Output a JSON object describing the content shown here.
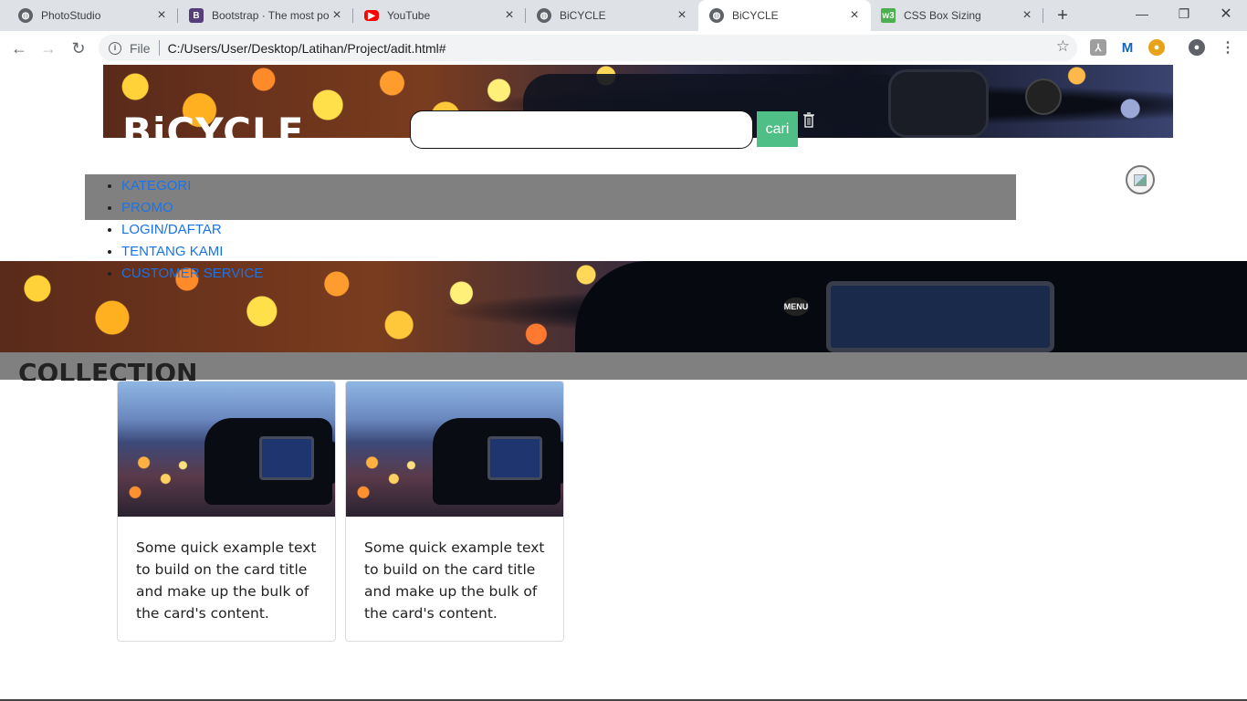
{
  "browser": {
    "tabs": [
      {
        "title": "PhotoStudio",
        "icon": "globe-icon"
      },
      {
        "title": "Bootstrap · The most po",
        "icon": "bootstrap-icon"
      },
      {
        "title": "YouTube",
        "icon": "youtube-icon"
      },
      {
        "title": "BiCYCLE",
        "icon": "globe-icon"
      },
      {
        "title": "BiCYCLE",
        "icon": "globe-icon",
        "active": true
      },
      {
        "title": "CSS Box Sizing",
        "icon": "w3schools-icon"
      }
    ],
    "new_tab": "+",
    "window_controls": {
      "minimize": "—",
      "restore": "❐",
      "close": "✕"
    },
    "address": {
      "scheme_label": "File",
      "url": "C:/Users/User/Desktop/Latihan/Project/adit.html#"
    }
  },
  "page": {
    "brand": "BiCYCLE",
    "search": {
      "placeholder": "",
      "value": "",
      "button_label": "cari"
    },
    "nav": [
      "KATEGORI",
      "PROMO",
      "LOGIN/DAFTAR",
      "TENTANG KAMI",
      "CUSTOMER SERVICE"
    ],
    "hero_menu_label": "MENU",
    "collection_title": "COLLECTION",
    "cards": [
      {
        "text": "Some quick example text to build on the card title and make up the bulk of the card's content."
      },
      {
        "text": "Some quick example text to build on the card title and make up the bulk of the card's content."
      }
    ]
  },
  "colors": {
    "nav_bar": "#808080",
    "search_button": "#4fbf87",
    "link": "#1a73e8"
  }
}
